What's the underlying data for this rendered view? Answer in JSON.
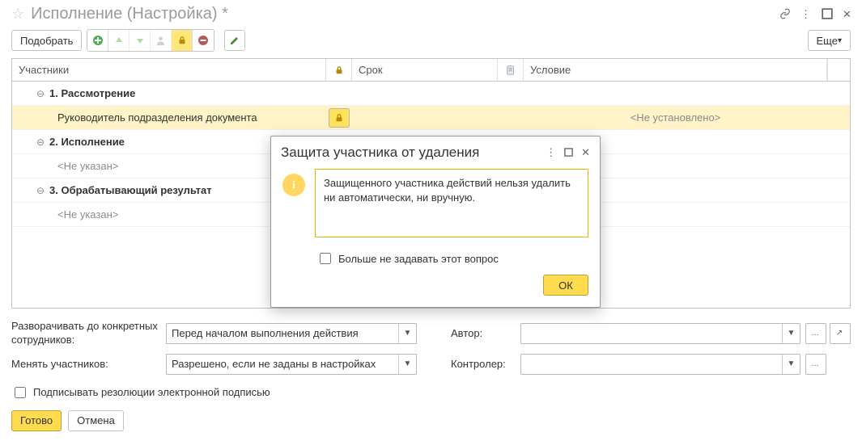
{
  "title": "Исполнение (Настройка) *",
  "toolbar": {
    "select_label": "Подобрать",
    "more_label": "Еще"
  },
  "table": {
    "headers": {
      "participants": "Участники",
      "due": "Срок",
      "condition": "Условие"
    },
    "rows": {
      "g1": "1. Рассмотрение",
      "r1_participant": "Руководитель подразделения документа",
      "r1_condition": "<Не установлено>",
      "g2": "2. Исполнение",
      "r2_participant": "<Не указан>",
      "g3": "3. Обрабатывающий результат",
      "r3_participant": "<Не указан>"
    }
  },
  "form": {
    "expand_label": "Разворачивать до конкретных сотрудников:",
    "expand_value": "Перед началом выполнения действия",
    "author_label": "Автор:",
    "change_label": "Менять участников:",
    "change_value": "Разрешено, если не заданы в настройках",
    "controller_label": "Контролер:",
    "sign_label": "Подписывать резолюции электронной подписью"
  },
  "footer": {
    "ok_label": "Готово",
    "cancel_label": "Отмена"
  },
  "modal": {
    "title": "Защита участника от удаления",
    "message": "Защищенного участника действий нельзя удалить ни автоматически, ни вручную.",
    "dont_ask": "Больше не задавать этот вопрос",
    "ok": "ОК"
  }
}
